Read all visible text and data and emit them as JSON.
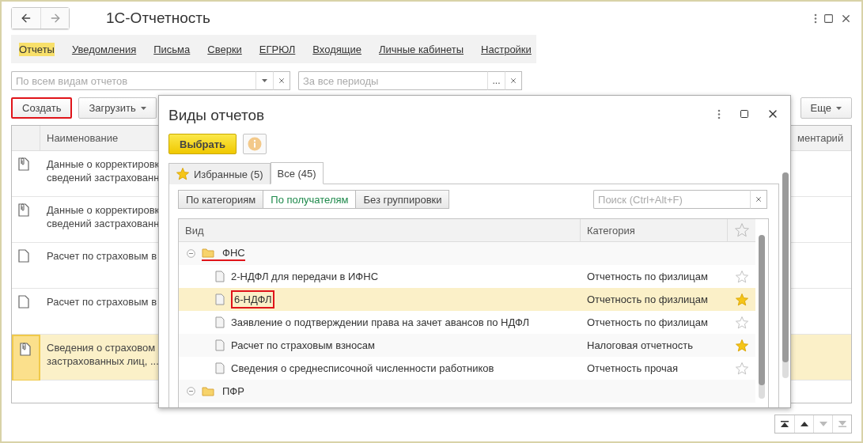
{
  "window": {
    "title": "1С-Отчетность"
  },
  "nav_tabs": [
    {
      "label": "Отчеты",
      "selected": true
    },
    {
      "label": "Уведомления",
      "selected": false
    },
    {
      "label": "Письма",
      "selected": false
    },
    {
      "label": "Сверки",
      "selected": false
    },
    {
      "label": "ЕГРЮЛ",
      "selected": false
    },
    {
      "label": "Входящие",
      "selected": false
    },
    {
      "label": "Личные кабинеты",
      "selected": false
    },
    {
      "label": "Настройки",
      "selected": false
    }
  ],
  "filters": [
    {
      "kind": "dropdown",
      "placeholder": "По всем видам отчетов"
    },
    {
      "kind": "picker",
      "placeholder": "За все периоды",
      "picker_label": "..."
    }
  ],
  "toolbar": {
    "buttons": [
      {
        "label": "Создать",
        "kind": "plain",
        "outlined": true
      },
      {
        "label": "Загрузить",
        "kind": "menu",
        "outlined": false
      }
    ],
    "more": "Еще"
  },
  "table": {
    "columns": [
      "Наименование",
      "ментарий"
    ],
    "rows": [
      {
        "kind": "attached",
        "selected": false,
        "lines": [
          "Данные о корректировк",
          "сведений застрахованн"
        ]
      },
      {
        "kind": "attached",
        "selected": false,
        "lines": [
          "Данные о корректировк",
          "сведений застрахованн"
        ]
      },
      {
        "kind": "plain",
        "selected": false,
        "lines": [
          "Расчет по страховым в"
        ]
      },
      {
        "kind": "plain",
        "selected": false,
        "lines": [
          "Расчет по страховым в"
        ]
      },
      {
        "kind": "attached",
        "selected": true,
        "lines": [
          "Сведения о страховом",
          "застрахованных лиц, ..."
        ]
      }
    ]
  },
  "pager": [
    {
      "kind": "first",
      "disabled": false
    },
    {
      "kind": "up",
      "disabled": false
    },
    {
      "kind": "down",
      "disabled": true
    },
    {
      "kind": "last",
      "disabled": true
    }
  ],
  "dialog": {
    "title": "Виды отчетов",
    "primary_button": "Выбрать",
    "tabs": [
      {
        "label": "Избранные (5)",
        "kind": "favorites",
        "selected": false
      },
      {
        "label": "Все (45)",
        "kind": "all",
        "selected": true
      }
    ],
    "grouping": [
      {
        "label": "По категориям",
        "selected": false
      },
      {
        "label": "По получателям",
        "selected": true
      },
      {
        "label": "Без группировки",
        "selected": false
      }
    ],
    "search": {
      "placeholder": "Поиск (Ctrl+Alt+F)"
    },
    "tree": {
      "columns": [
        "Вид",
        "Категория"
      ],
      "rows": [
        {
          "label": "ФНС",
          "expanded": true,
          "underlined": true,
          "children": [
            {
              "label": "2-НДФЛ для передачи в ИФНС",
              "category": "Отчетность по физлицам",
              "favorite": false,
              "selected": false,
              "outlined": false
            },
            {
              "label": "6-НДФЛ",
              "category": "Отчетность по физлицам",
              "favorite": true,
              "selected": true,
              "outlined": true
            },
            {
              "label": "Заявление о подтверждении права на зачет авансов по НДФЛ",
              "category": "Отчетность по физлицам",
              "favorite": false,
              "selected": false,
              "outlined": false
            },
            {
              "label": "Расчет по страховым взносам",
              "category": "Налоговая отчетность",
              "favorite": true,
              "selected": false,
              "outlined": false
            },
            {
              "label": "Сведения о среднесписочной численности работников",
              "category": "Отчетность прочая",
              "favorite": false,
              "selected": false,
              "outlined": false
            }
          ]
        },
        {
          "label": "ПФР",
          "expanded": true,
          "underlined": false
        }
      ]
    }
  }
}
